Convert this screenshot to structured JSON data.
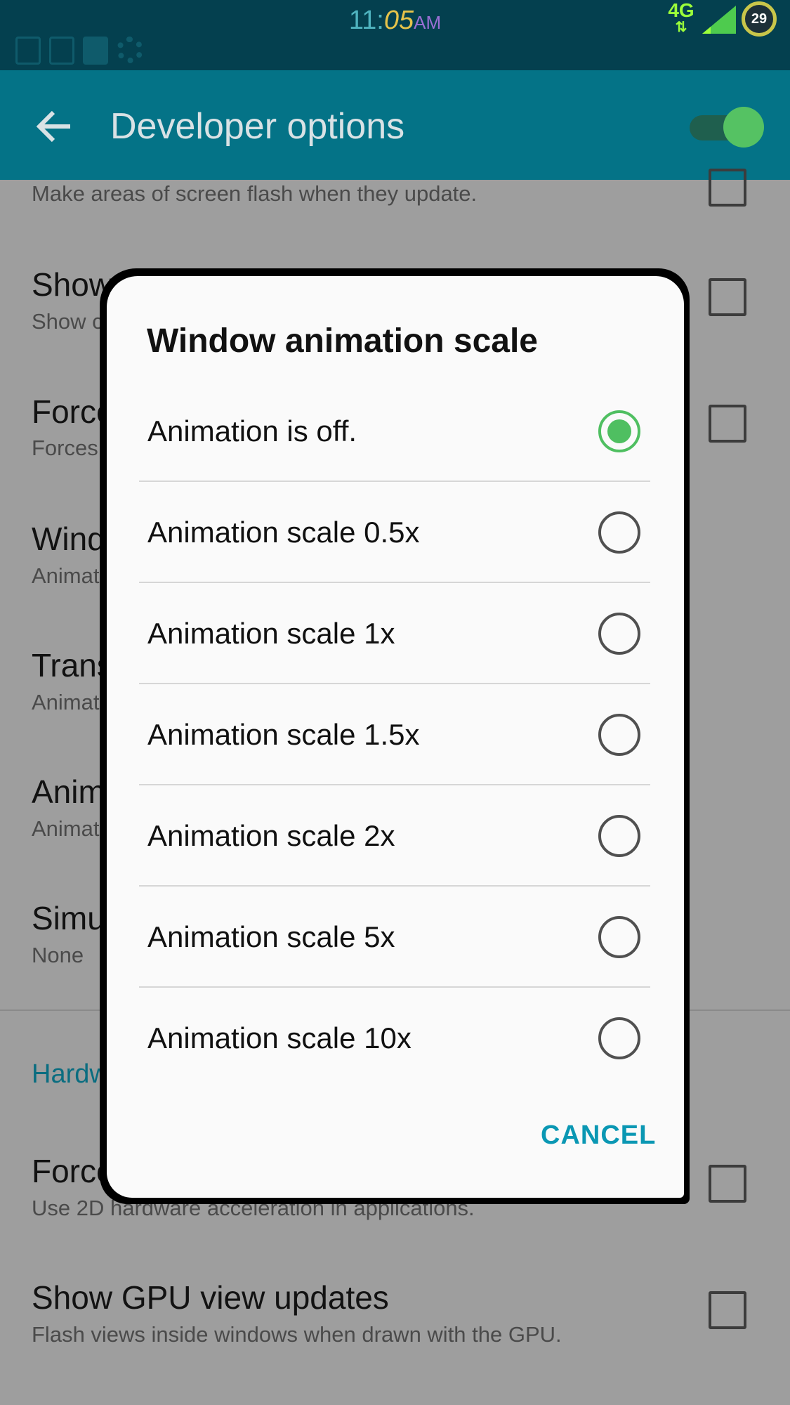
{
  "status_bar": {
    "time_hour": "11:",
    "time_minutes": "05",
    "time_ampm": "AM",
    "network": "4G",
    "network_arrows": "⇅",
    "battery": "29",
    "icons": [
      "screenshot-icon",
      "gallery-icon",
      "file-icon",
      "settings-icon"
    ]
  },
  "app_bar": {
    "title": "Developer options",
    "back_icon": "arrow-back-icon",
    "toggle_on": true,
    "accent": "#047387"
  },
  "settings": {
    "rows": [
      {
        "title": "",
        "subtitle": "Make areas of screen flash when they update."
      },
      {
        "title": "Show",
        "subtitle": "Show c"
      },
      {
        "title": "Force",
        "subtitle": "Forces"
      },
      {
        "title": "Wind",
        "subtitle": "Animat"
      },
      {
        "title": "Trans",
        "subtitle": "Animat"
      },
      {
        "title": "Anim",
        "subtitle": "Animat"
      },
      {
        "title": "Simu",
        "subtitle": "None"
      },
      {
        "title": "Force",
        "subtitle": "Use 2D hardware acceleration in applications."
      },
      {
        "title": "Show GPU view updates",
        "subtitle": "Flash views inside windows when drawn with the GPU."
      }
    ],
    "section_header": "Hardw"
  },
  "dialog": {
    "title": "Window animation scale",
    "options": [
      {
        "label": "Animation is off.",
        "selected": true
      },
      {
        "label": "Animation scale 0.5x",
        "selected": false
      },
      {
        "label": "Animation scale 1x",
        "selected": false
      },
      {
        "label": "Animation scale 1.5x",
        "selected": false
      },
      {
        "label": "Animation scale 2x",
        "selected": false
      },
      {
        "label": "Animation scale 5x",
        "selected": false
      },
      {
        "label": "Animation scale 10x",
        "selected": false
      }
    ],
    "cancel_label": "CANCEL",
    "selected_color": "#4fbf61"
  }
}
